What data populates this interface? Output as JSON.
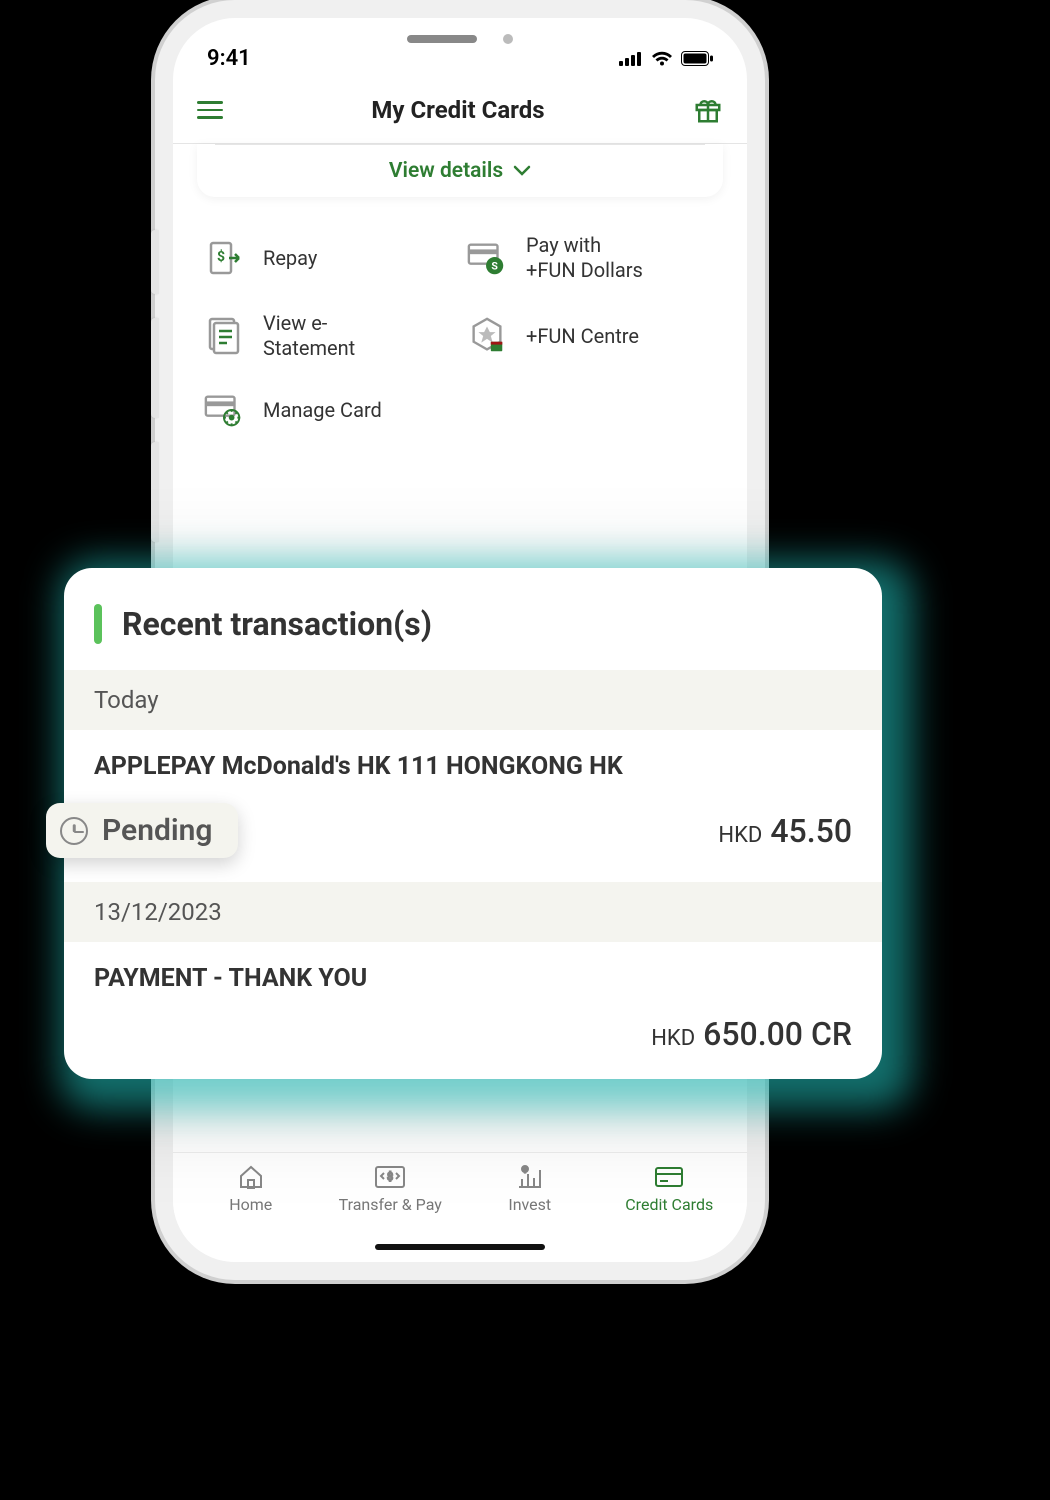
{
  "status": {
    "time": "9:41"
  },
  "header": {
    "title": "My Credit Cards"
  },
  "card": {
    "view_details": "View details"
  },
  "actions": {
    "repay": "Repay",
    "pay_fun_line1": "Pay with",
    "pay_fun_line2": "+FUN Dollars",
    "view_estatement_line1": "View e-",
    "view_estatement_line2": "Statement",
    "fun_centre": "+FUN Centre",
    "manage_card": "Manage Card"
  },
  "transactions": {
    "section_title": "Recent transaction(s)",
    "groups": [
      {
        "date_label": "Today",
        "items": [
          {
            "merchant": "APPLEPAY McDonald's HK 111 HONGKONG HK",
            "status": "Pending",
            "currency": "HKD",
            "amount": "45.50",
            "suffix": ""
          }
        ]
      },
      {
        "date_label": "13/12/2023",
        "items": [
          {
            "merchant": "PAYMENT - THANK YOU",
            "status": "",
            "currency": "HKD",
            "amount": "650.00",
            "suffix": "CR"
          }
        ]
      }
    ]
  },
  "tabbar": {
    "home": "Home",
    "transfer": "Transfer & Pay",
    "invest": "Invest",
    "credit_cards": "Credit Cards"
  }
}
